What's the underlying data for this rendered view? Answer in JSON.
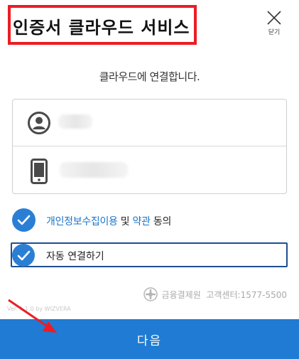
{
  "header": {
    "title": "인증서 클라우드 서비스",
    "close_label": "닫기"
  },
  "subtitle": "클라우드에 연결합니다.",
  "fields": {
    "name": {
      "icon": "user-circle-icon",
      "value": ""
    },
    "phone": {
      "icon": "mobile-phone-icon",
      "value": ""
    }
  },
  "agreement": {
    "checked": true,
    "privacy_link": "개인정보수집이용",
    "and_text": "및",
    "terms_link": "약관",
    "consent_text": "동의"
  },
  "auto_connect": {
    "checked": true,
    "label": "자동 연결하기"
  },
  "footer": {
    "provider": "금융결제원",
    "support": "고객센터:1577-5500",
    "version": "Ver. 1.1.0 by WIZVERA"
  },
  "next_button": "다음",
  "colors": {
    "primary": "#1f7bd3",
    "check": "#2a7fd4",
    "link": "#1a73c9",
    "annotation_red": "#ec1c24",
    "focus_border": "#1e4f91"
  }
}
